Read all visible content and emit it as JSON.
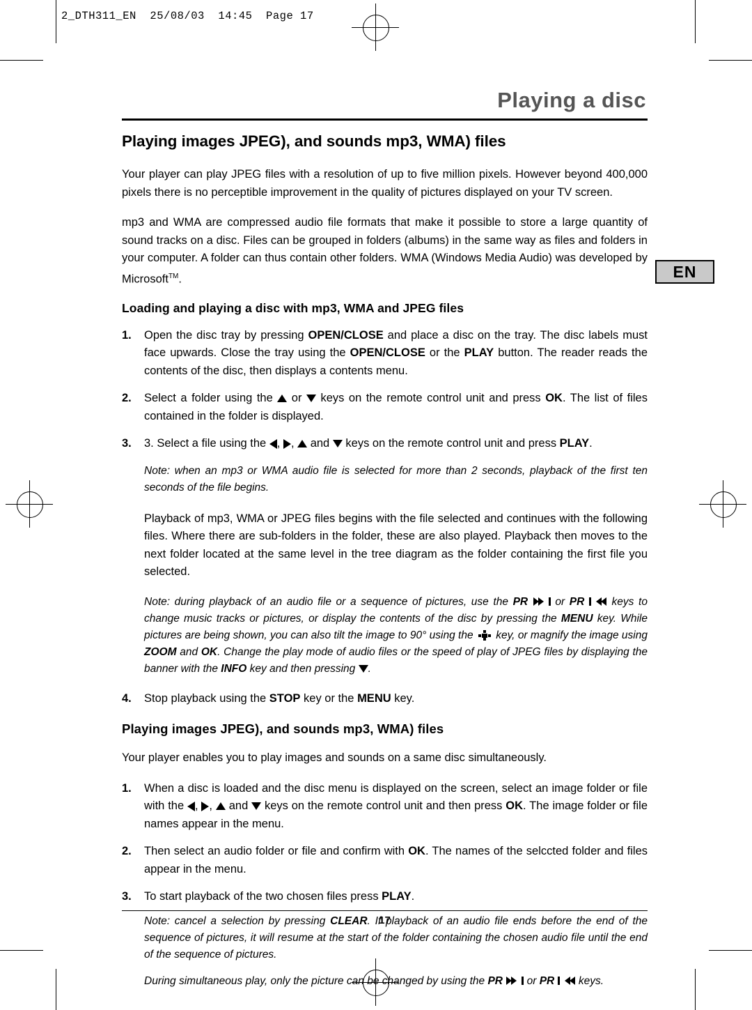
{
  "print_strip": "2_DTH311_EN  25/08/03  14:45  Page 17",
  "chapter_title": "Playing a disc",
  "en_badge": "EN",
  "page_number": "17",
  "section1": {
    "heading": "Playing images JPEG), and sounds mp3, WMA) files",
    "p1": "Your player can play JPEG files with a resolution of up to five million pixels. However beyond 400,000 pixels there is no perceptible improvement in the quality of pictures displayed on your TV screen.",
    "p2_a": "mp3 and WMA are compressed audio file formats that make it possible to store a large quantity of sound tracks on a disc. Files can be grouped in folders (albums) in the same way as files and folders in your computer. A folder can thus contain other folders. WMA (Windows Media Audio) was developed by Microsoft",
    "p2_tm": "TM",
    "p2_b": "."
  },
  "section2": {
    "heading": "Loading and playing a disc with mp3, WMA and JPEG files",
    "steps": [
      {
        "num": "1.",
        "text": "Open the disc tray by pressing OPEN/CLOSE and place a disc on the tray. The disc labels must face upwards. Close the tray using the OPEN/CLOSE or the PLAY button. The reader reads the contents of the disc, then displays a contents menu."
      },
      {
        "num": "2.",
        "text": "Select a folder using the [up] or [down] keys on the remote control unit and press OK. The list of files contained in the folder is displayed."
      },
      {
        "num": "3.",
        "text": "3. Select a file using the [left], [right], [up] and [down] keys on the remote control unit and press PLAY."
      },
      {
        "num": "4.",
        "text": "Stop playback using the STOP key or the MENU key."
      }
    ],
    "note1": "Note: when an mp3 or WMA audio file is selected for more than 2 seconds, playback of the first ten seconds of the file begins.",
    "para_playback": "Playback of mp3, WMA or JPEG files begins with the file selected and continues with the following files. Where there are sub-folders in the folder, these are also played. Playback then moves to the next folder located at the same level in the tree diagram as the folder containing the first file you selected.",
    "note2": "Note: during playback of an audio file or a sequence of pictures, use the PR [ffwd] or PR [frev] keys to change music tracks or pictures, or display the contents of the disc by pressing the MENU key. While pictures are being shown, you can also tilt the image to 90° using the [rotate] key, or magnify the image using ZOOM and OK. Change the play mode of audio files or the speed of play of JPEG files by displaying the banner with the INFO key and then pressing [down]."
  },
  "section3": {
    "heading": "Playing images JPEG), and sounds mp3, WMA) files",
    "intro": "Your player enables you to play images and sounds on a same disc simultaneously.",
    "steps": [
      {
        "num": "1.",
        "text": "When a disc is loaded and the disc menu is displayed on the screen, select an image folder or file with the [left], [right], [up] and [down] keys on the remote control unit and then press OK. The image folder or file names appear in the menu."
      },
      {
        "num": "2.",
        "text": "Then select an audio folder or file and confirm with OK. The names of the selccted folder and files appear in the menu."
      },
      {
        "num": "3.",
        "text": "To start playback of the two chosen files press PLAY."
      }
    ],
    "note1": "Note: cancel a selection by pressing CLEAR. If playback of an audio file ends before the end of the sequence of pictures, it will resume at the start of the folder containing the chosen audio file until the end of the sequence of pictures.",
    "note2": "During simultaneous play, only the picture can be changed by using the PR [ffwd] or PR [frev] keys."
  },
  "labels": {
    "open_close": "OPEN/CLOSE",
    "play": "PLAY",
    "ok": "OK",
    "stop": "STOP",
    "menu": "MENU",
    "zoom": "ZOOM",
    "info": "INFO",
    "clear": "CLEAR",
    "pr": "PR"
  }
}
